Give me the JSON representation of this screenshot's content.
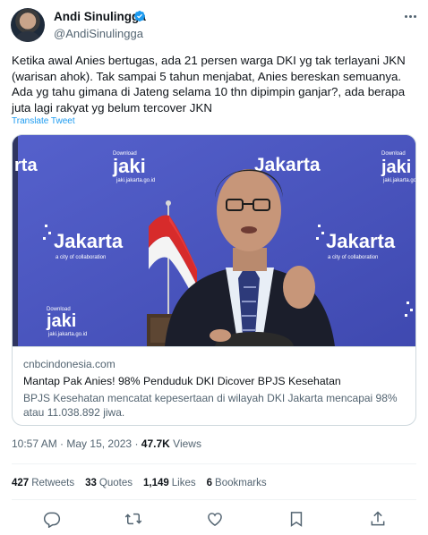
{
  "author": {
    "name": "Andi Sinulingga",
    "handle": "@AndiSinulingga",
    "verified": true,
    "avatar_icon": "avatar-photo"
  },
  "tweet": {
    "text": "Ketika awal Anies bertugas, ada 21 persen warga DKI yg tak terlayani JKN (warisan ahok). Tak sampai 5 tahun menjabat, Anies bereskan semuanya. Ada yg tahu gimana di Jateng selama 10 thn dipimpin ganjar?, ada berapa juta lagi rakyat yg belum tercover JKN",
    "translate_label": "Translate Tweet"
  },
  "card": {
    "image_text": {
      "jaki_top": "jaki",
      "jaki_top_sub": "jaki.jakarta.go.id",
      "jakarta_left": "Jakarta",
      "jakarta_left_sub": "a city of collaboration",
      "jakarta_right": "Jakarta",
      "jakarta_right_sub": "a city of collaboration",
      "jaki_bottom": "jaki",
      "jaki_bottom_sub": "jaki.jakarta.go.id",
      "download_label": "Download"
    },
    "domain": "cnbcindonesia.com",
    "title": "Mantap Pak Anies! 98% Penduduk DKI Dicover BPJS Kesehatan",
    "description": "BPJS Kesehatan mencatat kepesertaan di wilayah DKI Jakarta mencapai 98% atau 11.038.892 jiwa."
  },
  "meta": {
    "time": "10:57 AM",
    "separator": "·",
    "date": "May 15, 2023",
    "views_count": "47.7K",
    "views_label": "Views"
  },
  "stats": [
    {
      "count": "427",
      "label": "Retweets"
    },
    {
      "count": "33",
      "label": "Quotes"
    },
    {
      "count": "1,149",
      "label": "Likes"
    },
    {
      "count": "6",
      "label": "Bookmarks"
    }
  ],
  "actions": [
    "reply-icon",
    "retweet-icon",
    "like-icon",
    "bookmark-icon",
    "share-icon"
  ],
  "colors": {
    "accent": "#1d9bf0",
    "text": "#0f1419",
    "secondary": "#536471",
    "border": "#cfd9de",
    "banner": "#4a55c2"
  }
}
